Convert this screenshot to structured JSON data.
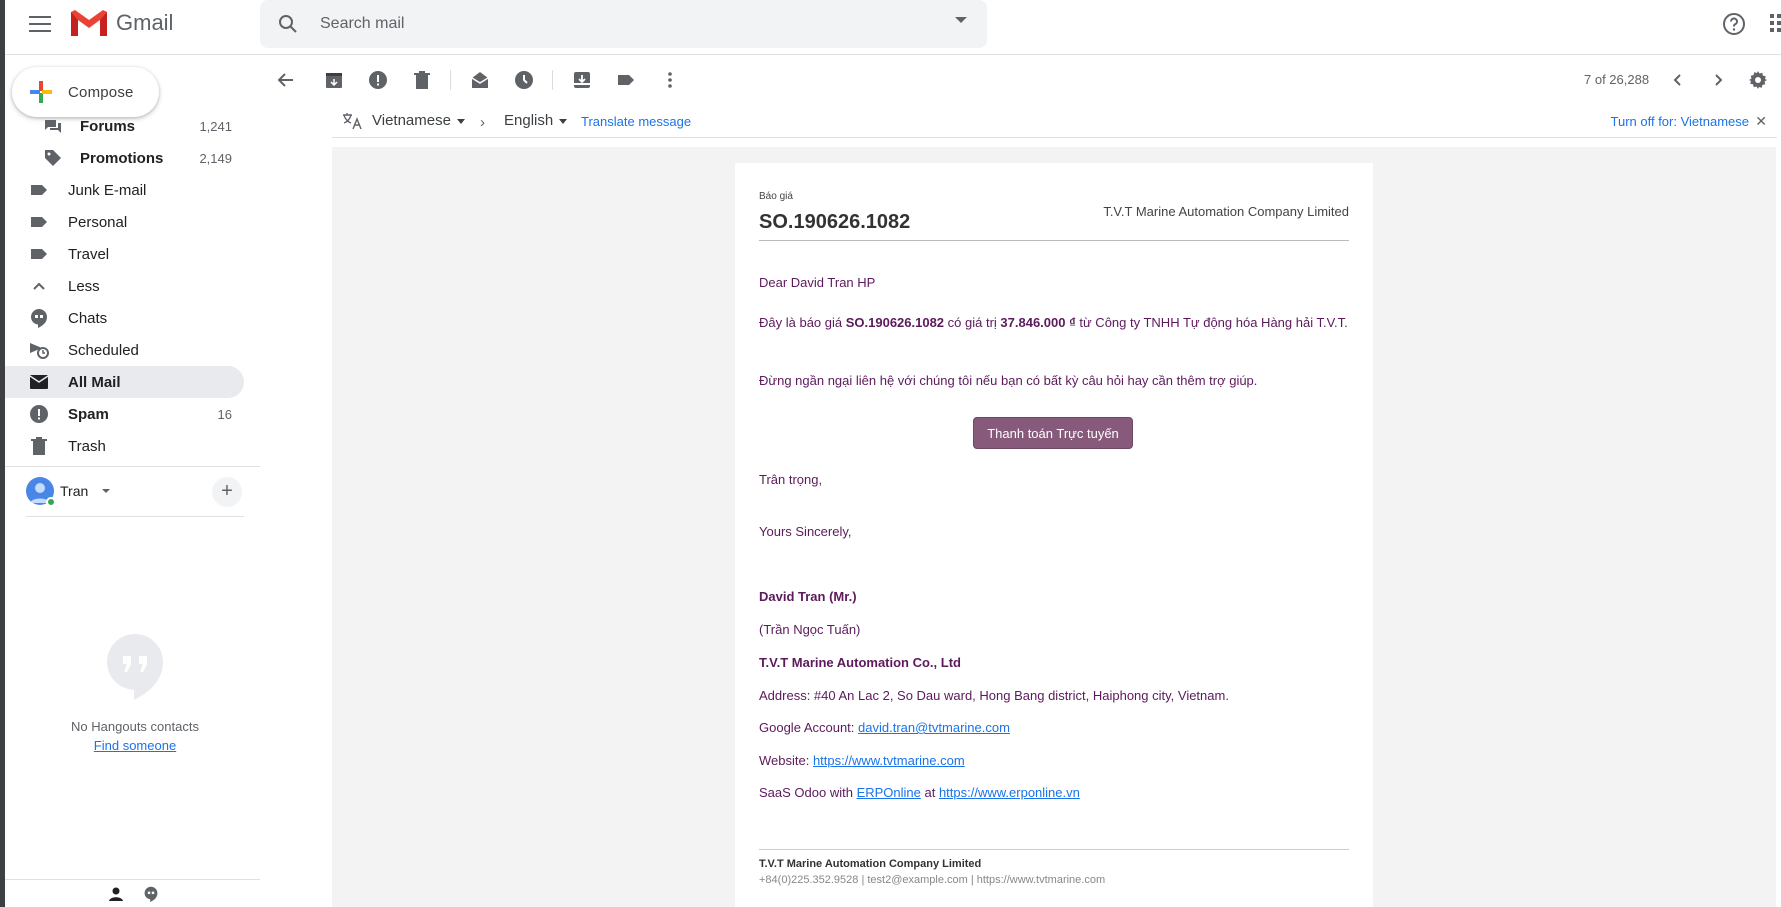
{
  "app": {
    "name": "Gmail"
  },
  "search": {
    "placeholder": "Search mail"
  },
  "compose_label": "Compose",
  "nav": {
    "forums": {
      "label": "Forums",
      "count": "1,241"
    },
    "promotions": {
      "label": "Promotions",
      "count": "2,149"
    },
    "junk": {
      "label": "Junk E-mail"
    },
    "personal": {
      "label": "Personal"
    },
    "travel": {
      "label": "Travel"
    },
    "less": {
      "label": "Less"
    },
    "chats": {
      "label": "Chats"
    },
    "scheduled": {
      "label": "Scheduled"
    },
    "all_mail": {
      "label": "All Mail"
    },
    "spam": {
      "label": "Spam",
      "count": "16"
    },
    "trash": {
      "label": "Trash"
    }
  },
  "hangouts": {
    "user_name": "Tran",
    "no_contacts": "No Hangouts contacts",
    "find_someone": "Find someone"
  },
  "toolbar": {
    "pager": "7 of 26,288"
  },
  "translate": {
    "from_lang": "Vietnamese",
    "to_lang": "English",
    "translate_link": "Translate message",
    "turn_off": "Turn off for: Vietnamese"
  },
  "email": {
    "category": "Báo giá",
    "so_number": "SO.190626.1082",
    "company_header": "T.V.T Marine Automation Company Limited",
    "greeting": "Dear David Tran HP",
    "body_prefix": "Đây là báo giá ",
    "body_so": "SO.190626.1082",
    "body_mid": " có giá trị ",
    "body_amount": "37.846.000 ₫",
    "body_suffix": " từ Công ty TNHH Tự động hóa Hàng hải T.V.T.",
    "body_help": "Đừng ngần ngại liên hệ với chúng tôi nếu bạn có bất kỳ câu hỏi hay cần thêm trợ giúp.",
    "pay_button": "Thanh toán Trực tuyến",
    "regards": "Trân trọng,",
    "sincerely": "Yours Sincerely,",
    "sig_name": "David Tran (Mr.)",
    "sig_name_vi": "(Trần Ngọc Tuấn)",
    "sig_company": "T.V.T Marine Automation Co., Ltd",
    "sig_address": "Address: #40 An Lac 2, So Dau ward, Hong Bang district, Haiphong city, Vietnam.",
    "sig_google_label": "Google Account: ",
    "sig_google_email": "david.tran@tvtmarine.com",
    "sig_website_label": "Website: ",
    "sig_website": "https://www.tvtmarine.com",
    "sig_saas_prefix": "SaaS Odoo with ",
    "sig_erp_link": "ERPOnline",
    "sig_at": " at ",
    "sig_erp_url": "https://www.erponline.vn",
    "footer_company": "T.V.T Marine Automation Company Limited",
    "footer_contact": "+84(0)225.352.9528 | test2@example.com | https://www.tvtmarine.com"
  },
  "colors": {
    "accent_blue": "#1a73e8",
    "message_text": "#5c1a5c",
    "pay_button": "#875a7b"
  }
}
